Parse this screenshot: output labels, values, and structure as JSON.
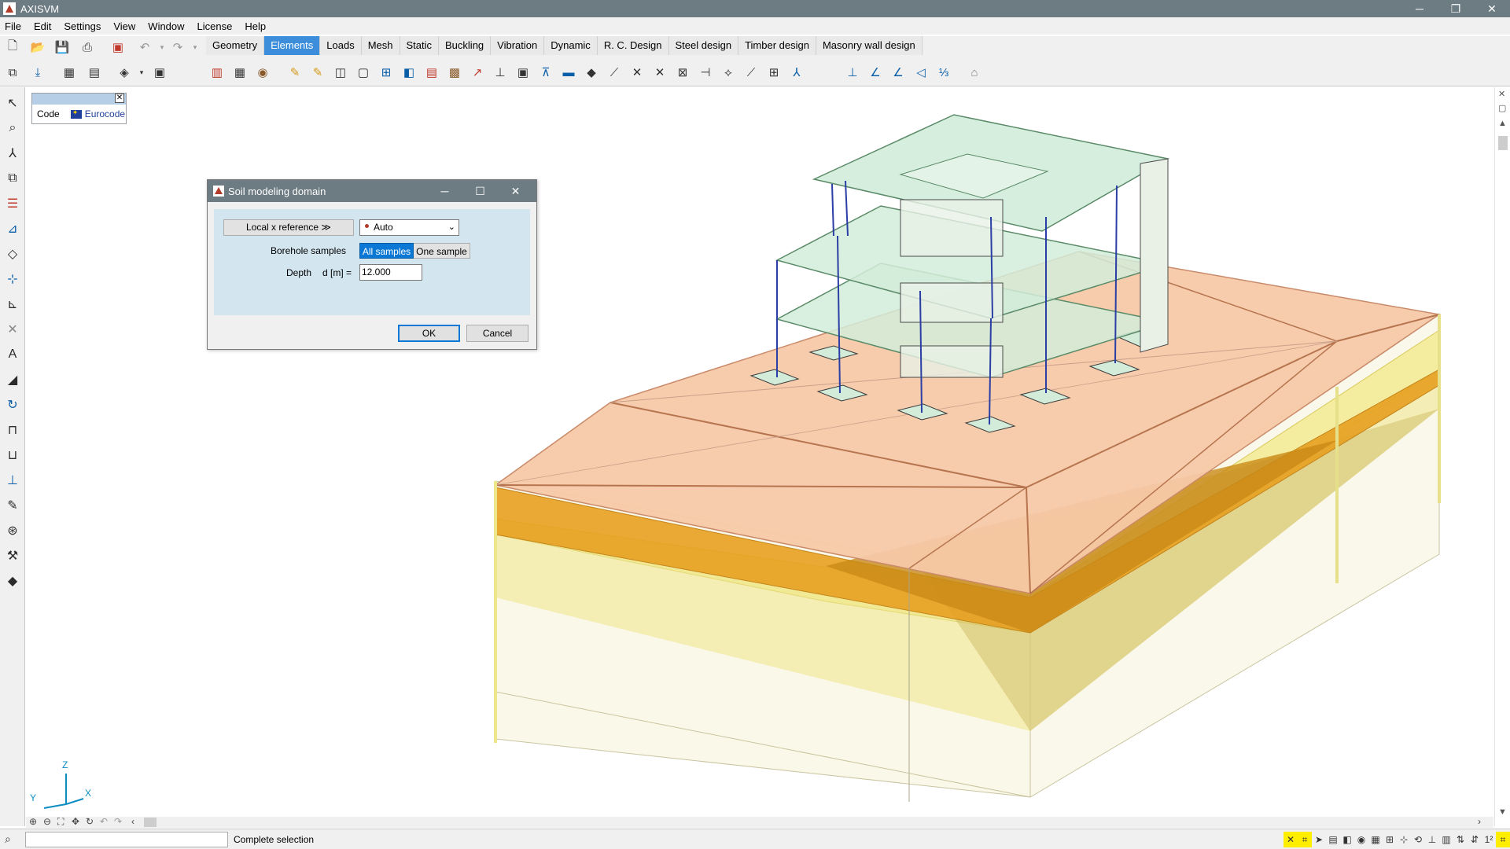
{
  "window": {
    "title": "AXISVM",
    "minimize": "─",
    "restore": "❐",
    "close": "✕"
  },
  "menu": [
    "File",
    "Edit",
    "Settings",
    "View",
    "Window",
    "License",
    "Help"
  ],
  "tabs": [
    {
      "label": "Geometry",
      "active": false
    },
    {
      "label": "Elements",
      "active": true
    },
    {
      "label": "Loads",
      "active": false
    },
    {
      "label": "Mesh",
      "active": false
    },
    {
      "label": "Static",
      "active": false
    },
    {
      "label": "Buckling",
      "active": false
    },
    {
      "label": "Vibration",
      "active": false
    },
    {
      "label": "Dynamic",
      "active": false
    },
    {
      "label": "R. C. Design",
      "active": false
    },
    {
      "label": "Steel design",
      "active": false
    },
    {
      "label": "Timber design",
      "active": false
    },
    {
      "label": "Masonry wall design",
      "active": false
    }
  ],
  "code_palette": {
    "label": "Code",
    "value": "Eurocode",
    "close": "✕"
  },
  "dialog": {
    "title": "Soil modeling domain",
    "minimize": "─",
    "maximize": "☐",
    "close": "✕",
    "local_x_button": "Local x reference ≫",
    "local_x_value": "Auto",
    "borehole_label": "Borehole samples",
    "borehole_all": "All samples",
    "borehole_one": "One sample",
    "depth_label": "Depth",
    "depth_unit": "d [m] =",
    "depth_value": "12.000",
    "ok": "OK",
    "cancel": "Cancel"
  },
  "axes": {
    "z": "Z",
    "y": "Y",
    "x": "X"
  },
  "status": {
    "text": "Complete selection",
    "scale_label": "1²"
  },
  "colors": {
    "accent": "#3c8edb",
    "titlebar": "#6d7b82",
    "soil_top": "#f6c9a8",
    "soil_layer": "#e7a020",
    "soil_lower": "#f3ee8a",
    "slab": "#d2ecd9",
    "column": "#2b3ea5"
  }
}
